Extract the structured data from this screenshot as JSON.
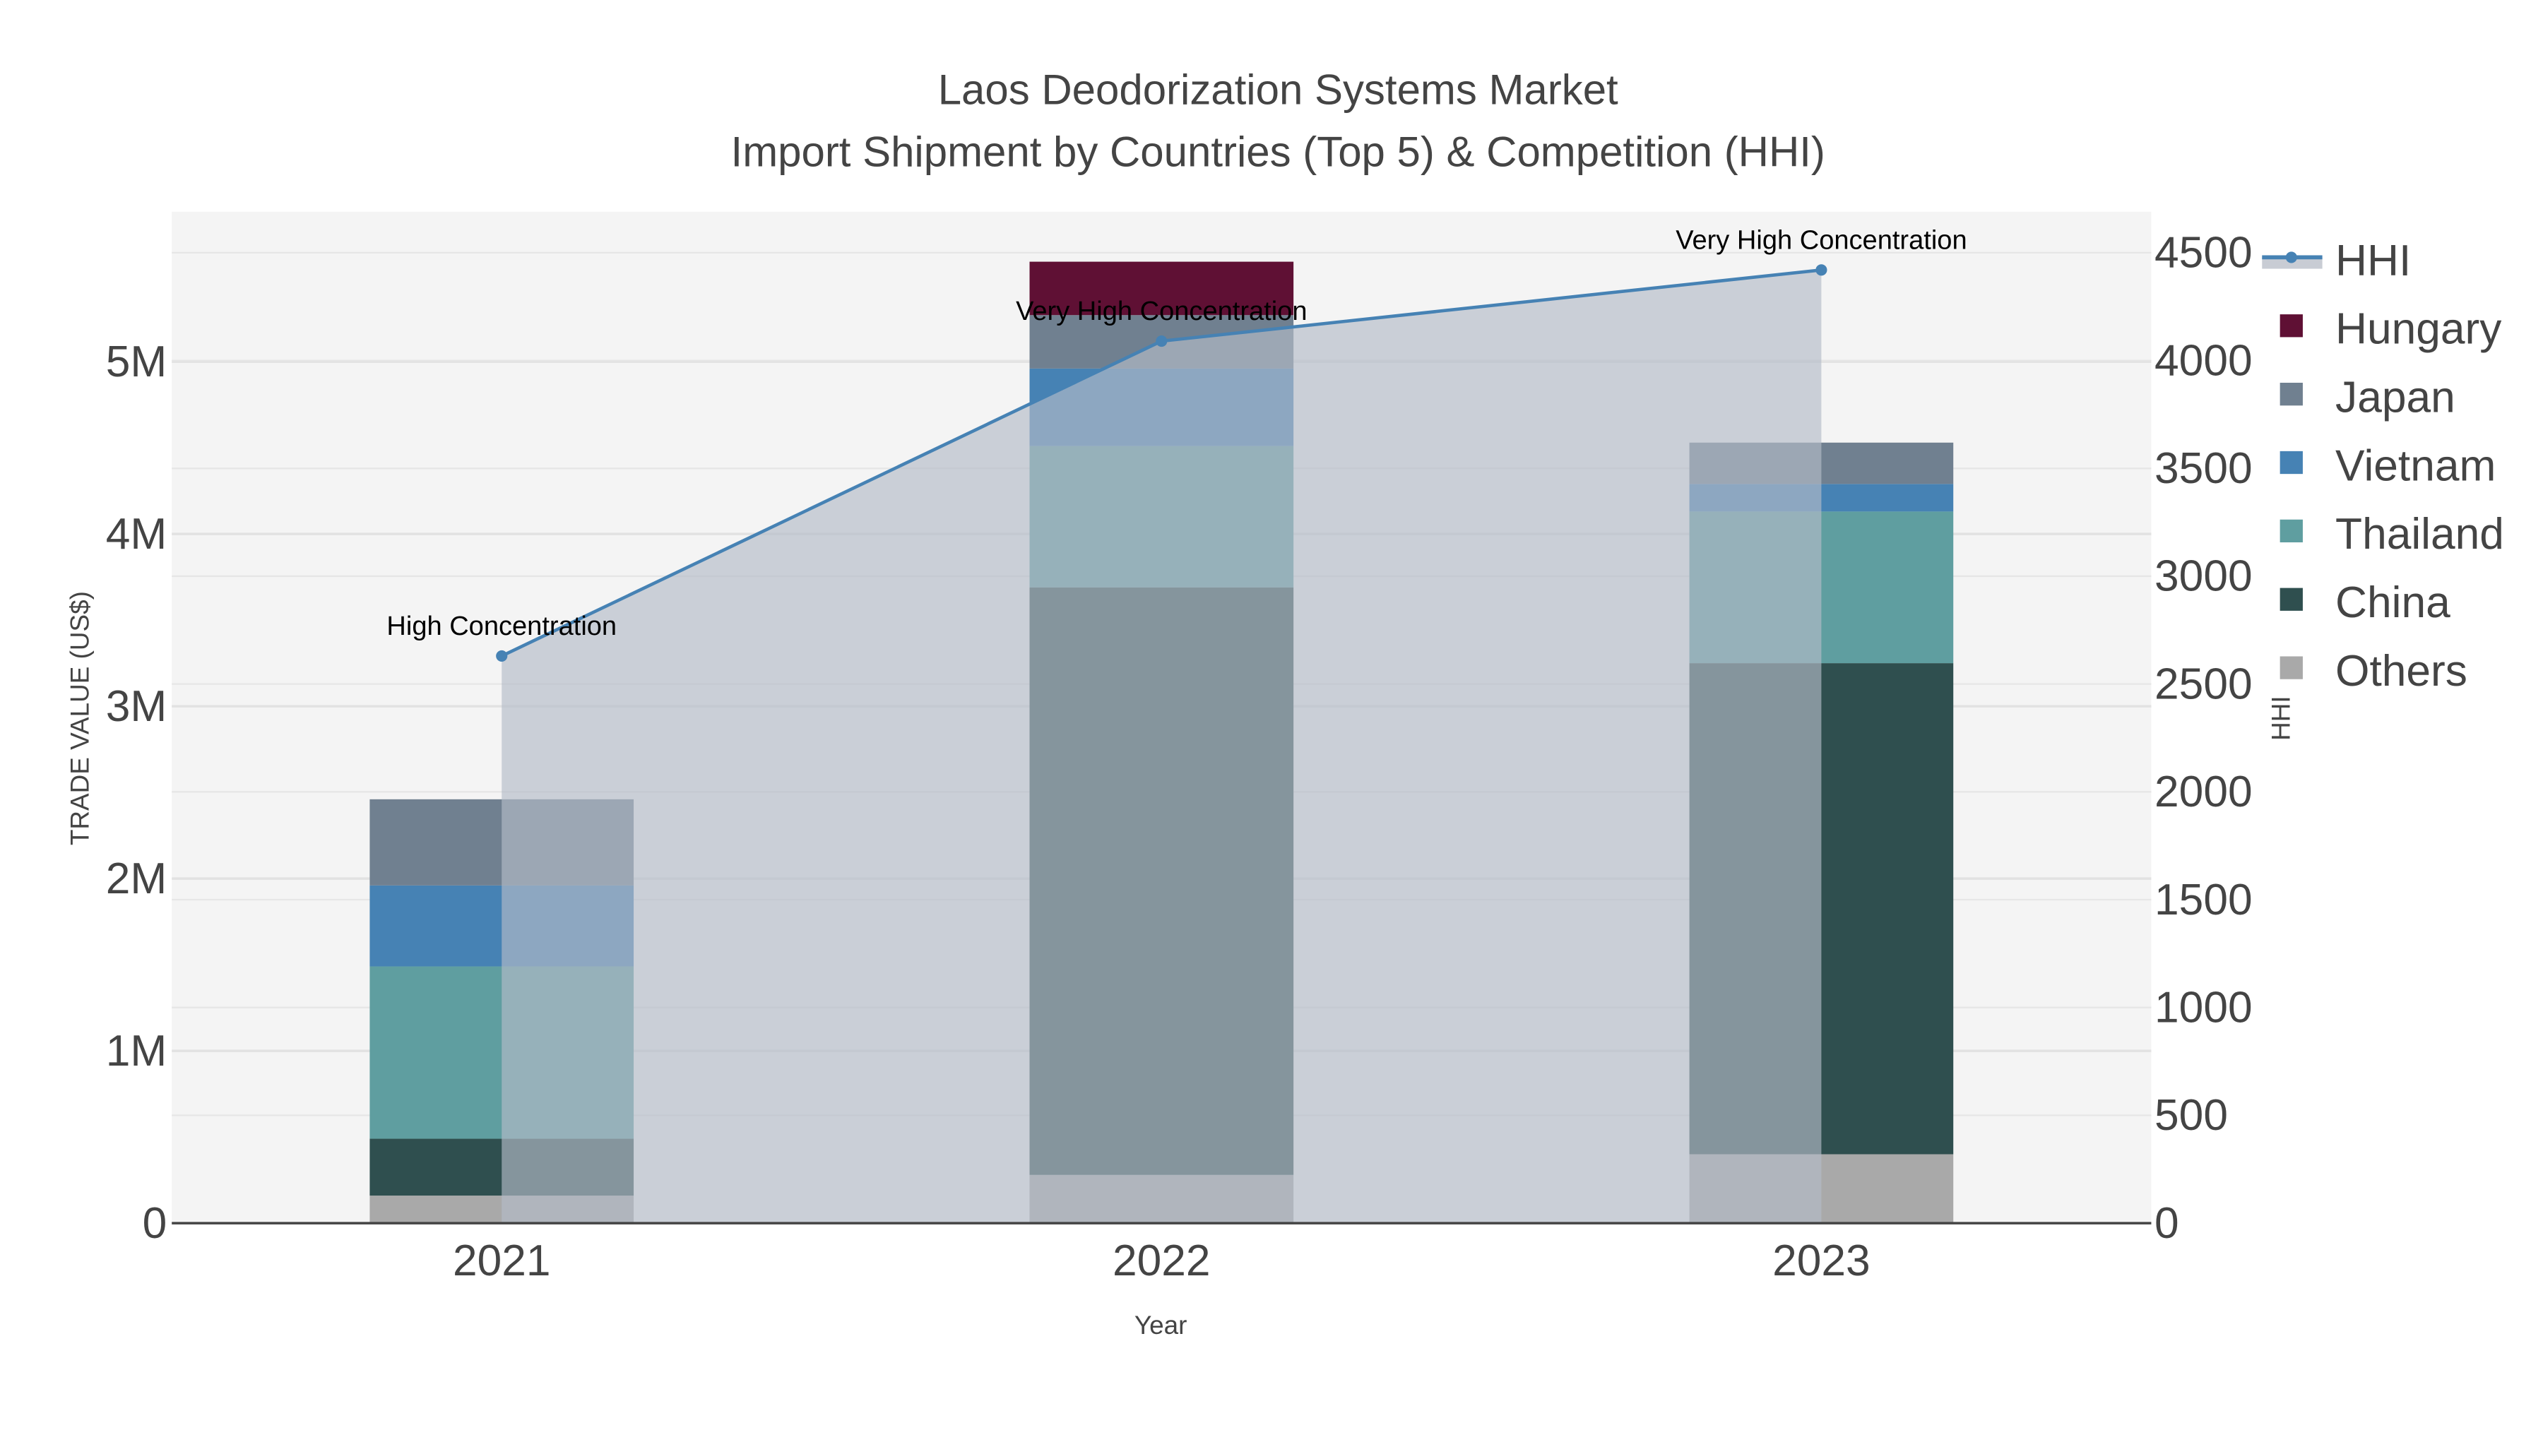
{
  "chart_data": {
    "type": "bar",
    "title": "Laos Deodorization Systems Market",
    "subtitle": "Import Shipment by Countries (Top 5) & Competition (HHI)",
    "xlabel": "Year",
    "ylabel": "TRADE VALUE (US$)",
    "y2label": "HHI",
    "categories": [
      "2021",
      "2022",
      "2023"
    ],
    "stacked": true,
    "ylim": [
      0,
      5870000
    ],
    "y2lim": [
      0,
      4690
    ],
    "yticks": [
      {
        "v": 0,
        "label": "0"
      },
      {
        "v": 1000000,
        "label": "1M"
      },
      {
        "v": 2000000,
        "label": "2M"
      },
      {
        "v": 3000000,
        "label": "3M"
      },
      {
        "v": 4000000,
        "label": "4M"
      },
      {
        "v": 5000000,
        "label": "5M"
      }
    ],
    "y2ticks": [
      {
        "v": 0,
        "label": "0"
      },
      {
        "v": 500,
        "label": "500"
      },
      {
        "v": 1000,
        "label": "1000"
      },
      {
        "v": 1500,
        "label": "1500"
      },
      {
        "v": 2000,
        "label": "2000"
      },
      {
        "v": 2500,
        "label": "2500"
      },
      {
        "v": 3000,
        "label": "3000"
      },
      {
        "v": 3500,
        "label": "3500"
      },
      {
        "v": 4000,
        "label": "4000"
      },
      {
        "v": 4500,
        "label": "4500"
      }
    ],
    "grid": true,
    "legend_position": "right",
    "series": [
      {
        "name": "Others",
        "color": "#a9a9a9",
        "values": [
          160000,
          280000,
          400000
        ]
      },
      {
        "name": "China",
        "color": "#2f4f4f",
        "values": [
          330000,
          3410000,
          2850000
        ]
      },
      {
        "name": "Thailand",
        "color": "#5f9ea0",
        "values": [
          1000000,
          820000,
          880000
        ]
      },
      {
        "name": "Vietnam",
        "color": "#4682b4",
        "values": [
          470000,
          450000,
          160000
        ]
      },
      {
        "name": "Japan",
        "color": "#708090",
        "values": [
          500000,
          310000,
          240000
        ]
      },
      {
        "name": "Hungary",
        "color": "#5f1034",
        "values": [
          0,
          310000,
          0
        ]
      }
    ],
    "hhi": {
      "name": "HHI",
      "color": "#4682b4",
      "fill": "#c8ccd4",
      "values": [
        2630,
        4090,
        4420
      ],
      "annotations": [
        "High Concentration",
        "Very High Concentration",
        "Very High Concentration"
      ]
    },
    "legend_order": [
      "HHI",
      "Hungary",
      "Japan",
      "Vietnam",
      "Thailand",
      "China",
      "Others"
    ]
  }
}
